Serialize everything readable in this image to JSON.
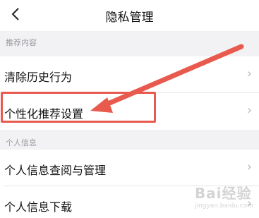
{
  "nav": {
    "title": "隐私管理",
    "back_glyph": "<"
  },
  "sections": {
    "recommend_header": "推荐内容",
    "personal_header": "个人信息"
  },
  "rows": [
    {
      "label": "清除历史行为"
    },
    {
      "label": "个性化推荐设置"
    },
    {
      "label": "个人信息查阅与管理"
    },
    {
      "label": "个人信息下载"
    }
  ],
  "annotation": {
    "color": "#e85a4e"
  },
  "watermark": {
    "text": "Bai经验",
    "url": "jingyan.baidu.com"
  }
}
